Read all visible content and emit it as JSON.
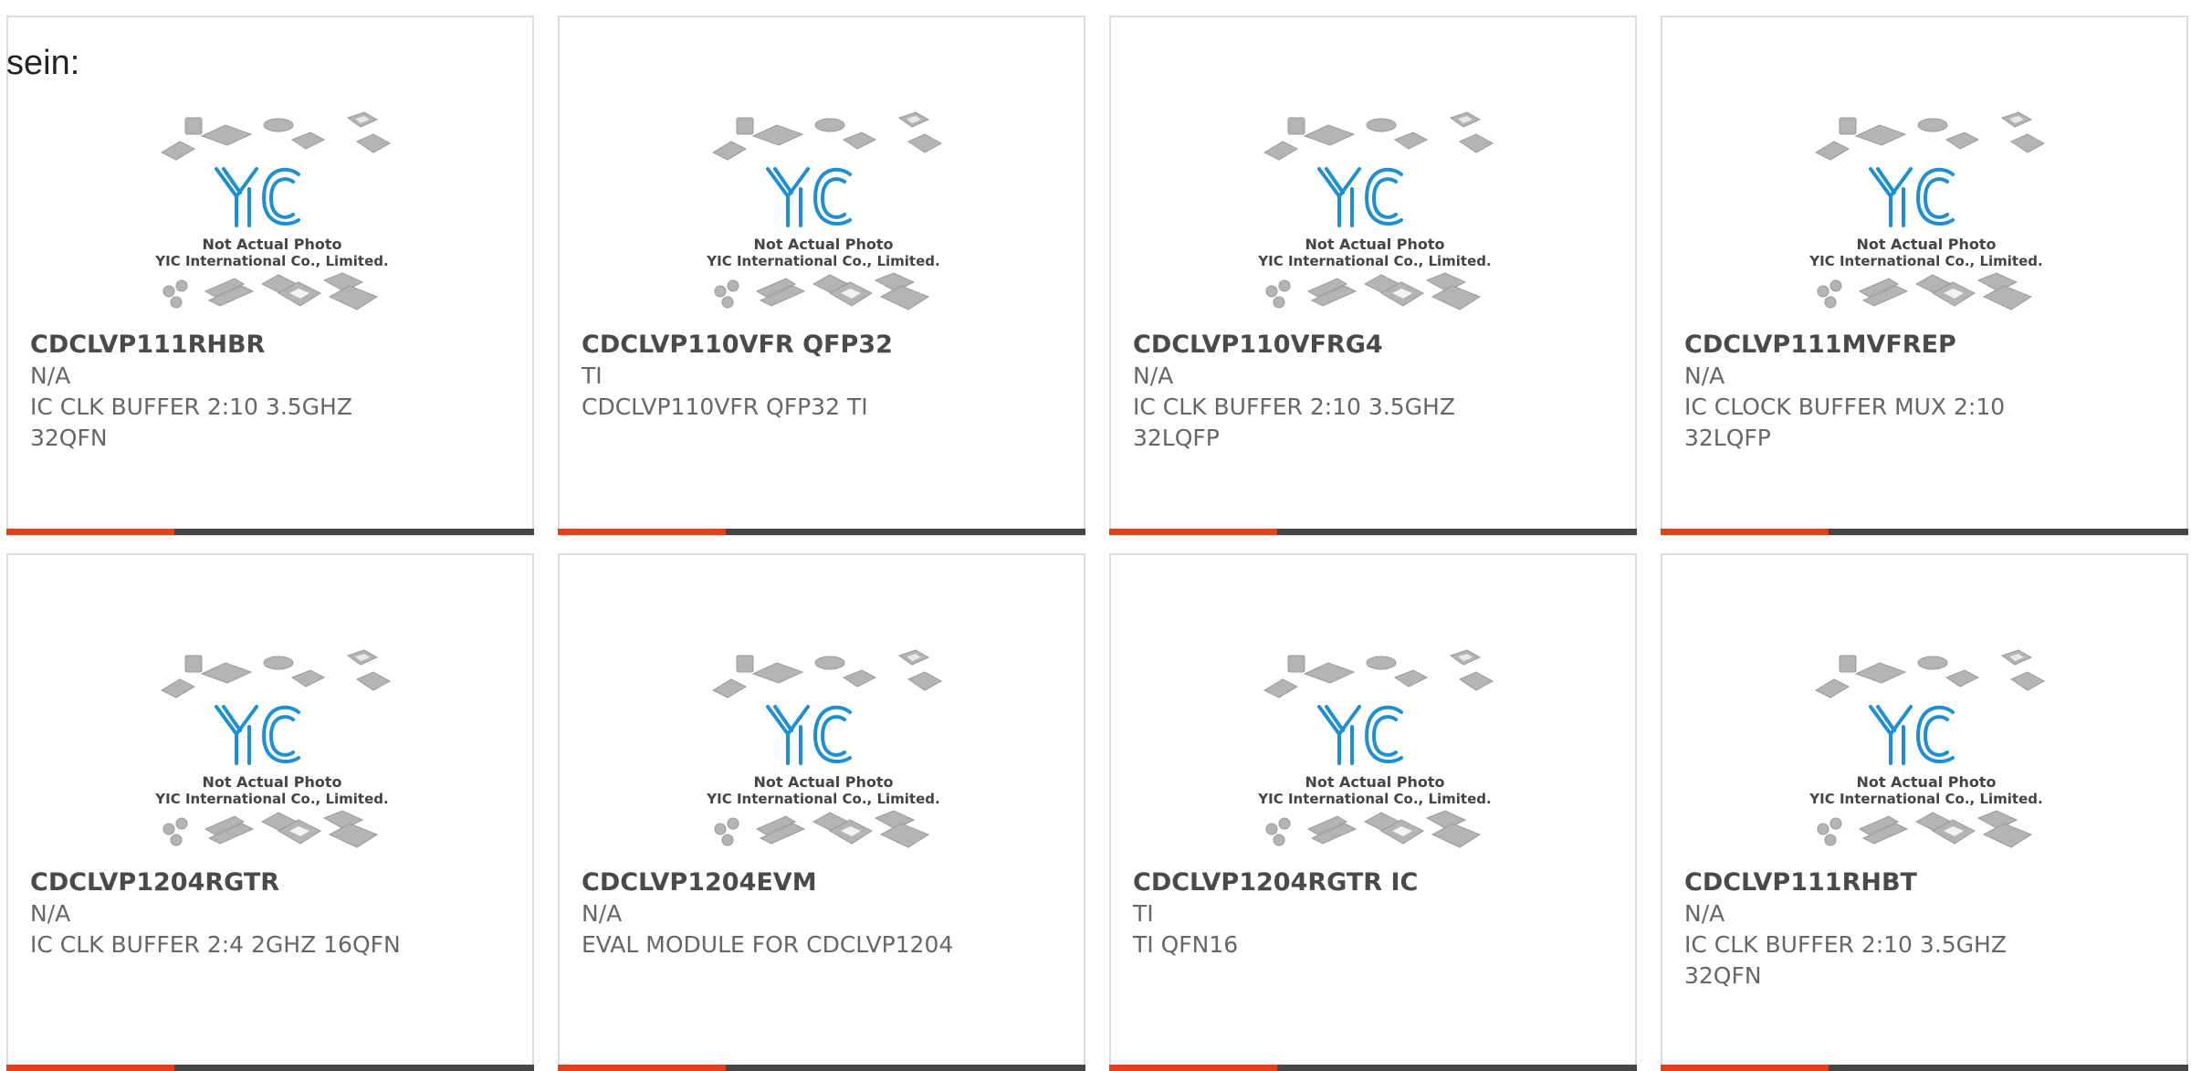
{
  "intro_text": "sein:",
  "photo": {
    "notice_line1": "Not Actual Photo",
    "notice_line2": "YIC International Co., Limited.",
    "logo_text": "YIC"
  },
  "colors": {
    "accent": "#e2401c",
    "bar_dark": "#454545",
    "logo_blue": "#1e8fd0"
  },
  "products": [
    {
      "part": "CDCLVP111RHBR",
      "mfr": "N/A",
      "desc": "IC CLK BUFFER 2:10 3.5GHZ 32QFN"
    },
    {
      "part": "CDCLVP110VFR QFP32",
      "mfr": "TI",
      "desc": "CDCLVP110VFR QFP32 TI"
    },
    {
      "part": "CDCLVP110VFRG4",
      "mfr": "N/A",
      "desc": "IC CLK BUFFER 2:10 3.5GHZ 32LQFP"
    },
    {
      "part": "CDCLVP111MVFREP",
      "mfr": "N/A",
      "desc": "IC CLOCK BUFFER MUX 2:10 32LQFP"
    },
    {
      "part": "CDCLVP1204RGTR",
      "mfr": "N/A",
      "desc": "IC CLK BUFFER 2:4 2GHZ 16QFN"
    },
    {
      "part": "CDCLVP1204EVM",
      "mfr": "N/A",
      "desc": "EVAL MODULE FOR CDCLVP1204"
    },
    {
      "part": "CDCLVP1204RGTR IC",
      "mfr": "TI",
      "desc": "TI QFN16"
    },
    {
      "part": "CDCLVP111RHBT",
      "mfr": "N/A",
      "desc": "IC CLK BUFFER 2:10 3.5GHZ 32QFN"
    }
  ]
}
